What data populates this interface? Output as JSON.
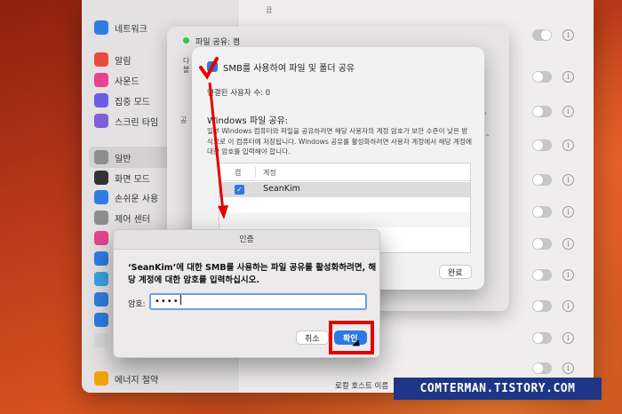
{
  "sidebar": {
    "items": [
      {
        "label": "네트워크",
        "color": "#2f7de1",
        "icon": "globe-icon"
      },
      {
        "label": "알림",
        "color": "#e74c3c",
        "icon": "bell-icon"
      },
      {
        "label": "사운드",
        "color": "#e84393",
        "icon": "speaker-icon"
      },
      {
        "label": "집중 모드",
        "color": "#6c5ce7",
        "icon": "moon-icon"
      },
      {
        "label": "스크린 타임",
        "color": "#7d5fd6",
        "icon": "hourglass-icon"
      },
      {
        "label": "일반",
        "color": "#8d8d8d",
        "icon": "gear-icon"
      },
      {
        "label": "화면 모드",
        "color": "#333333",
        "icon": "appearance-icon"
      },
      {
        "label": "손쉬운 사용",
        "color": "#2f7de1",
        "icon": "accessibility-icon"
      },
      {
        "label": "제어 센터",
        "color": "#8d8d8d",
        "icon": "control-center-icon"
      },
      {
        "label": "",
        "color": "#e84393",
        "icon": "siri-icon"
      },
      {
        "label": "",
        "color": "#2f7de1",
        "icon": "hand-icon"
      },
      {
        "label": "",
        "color": "#3aa3e3",
        "icon": "wallpaper-icon"
      },
      {
        "label": "",
        "color": "#2f7de1",
        "icon": "screensaver-icon"
      },
      {
        "label": "",
        "color": "#2f7de1",
        "icon": "battery-icon"
      },
      {
        "label": "",
        "color": "#d9d9d9",
        "icon": "lock-icon"
      },
      {
        "label": "에너지 절약",
        "color": "#f0a500",
        "icon": "energy-icon"
      }
    ]
  },
  "main": {
    "top_text": "끔",
    "file_sharing_label": "파일 공유: 켬",
    "partial_labels": [
      "다",
      "볼",
      "공"
    ],
    "local_host_label": "로컬 호스트 이름"
  },
  "smb_sheet": {
    "title": "SMB를 사용하여 파일 및 폴더 공유",
    "connected_users": "연결된 사용자 수: 0",
    "windows_title": "Windows 파일 공유:",
    "description": "일부 Windows 컴퓨터와 파일을 공유하려면 해당 사용자의 계정 암호가 보안 수준이 낮은 방식으로 이 컴퓨터에 저장됩니다. Windows 공유를 활성화하려면 사용자 계정에서 해당 계정에 대한 암호를 입력해야 합니다.",
    "table": {
      "col_on": "켬",
      "col_account": "계정",
      "rows": [
        {
          "checked": true,
          "name": "SeanKim"
        }
      ]
    },
    "done_label": "완료"
  },
  "auth_dialog": {
    "title": "인증",
    "message": "‘SeanKim’에 대한 SMB를 사용하는 파일 공유를 활성화하려면, 해당 계정에 대한 암호를 입력하십시오.",
    "password_label": "암호:",
    "password_value": "••••",
    "cancel_label": "취소",
    "ok_label": "확인"
  },
  "watermark": "COMTERMAN.TISTORY.COM",
  "colors": {
    "accent": "#2a7ae2",
    "annotation": "#e40000"
  }
}
